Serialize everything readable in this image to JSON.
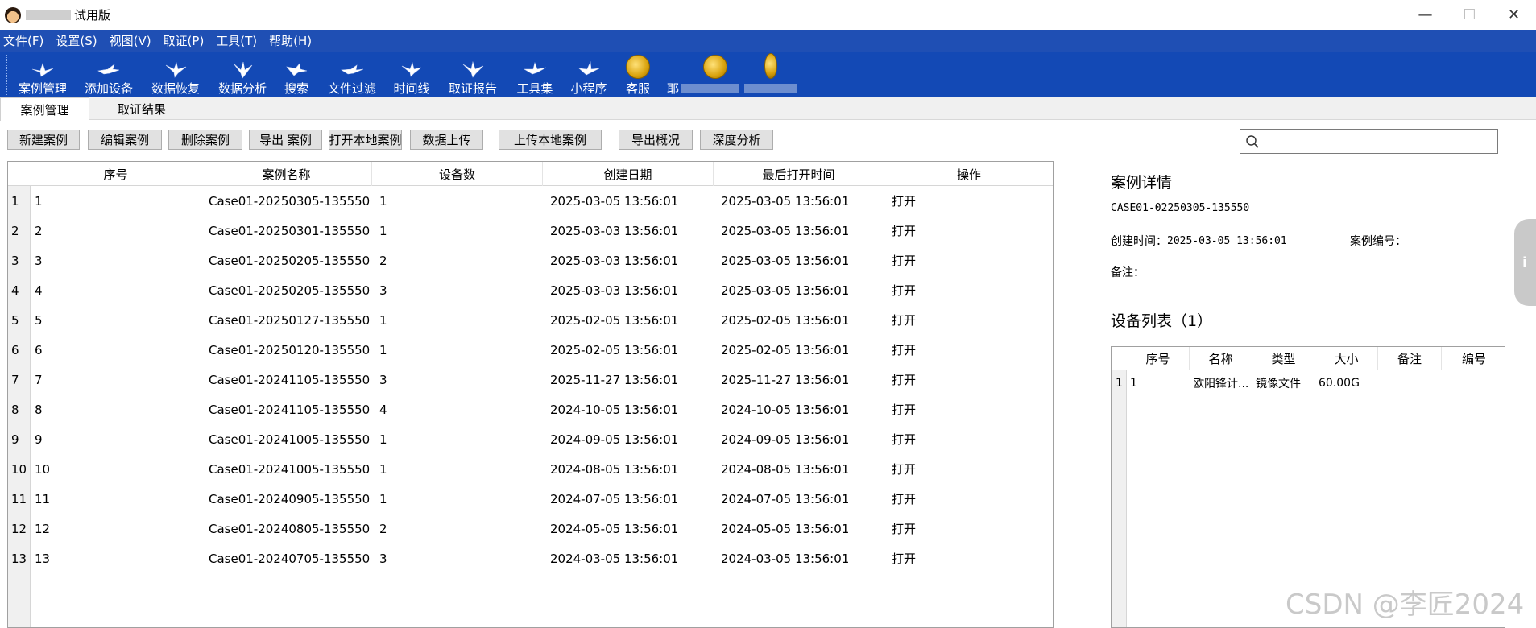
{
  "window": {
    "title": "试用版",
    "minimize_glyph": "—",
    "maximize_glyph": "☐",
    "close_glyph": "✕"
  },
  "menu": [
    "文件(F)",
    "设置(S)",
    "视图(V)",
    "取证(P)",
    "工具(T)",
    "帮助(H)"
  ],
  "toolbar": [
    {
      "label": "案例管理",
      "icon": "bird-icon"
    },
    {
      "label": "添加设备",
      "icon": "bird-icon"
    },
    {
      "label": "数据恢复",
      "icon": "bird-icon"
    },
    {
      "label": "数据分析",
      "icon": "bird-icon"
    },
    {
      "label": "搜索",
      "icon": "bird-icon"
    },
    {
      "label": "文件过滤",
      "icon": "bird-icon"
    },
    {
      "label": "时间线",
      "icon": "bird-icon"
    },
    {
      "label": "取证报告",
      "icon": "bird-icon"
    },
    {
      "label": "工具集",
      "icon": "bird-icon"
    },
    {
      "label": "小程序",
      "icon": "bird-icon"
    },
    {
      "label": "客服",
      "icon": "coin-icon"
    },
    {
      "label": "耶",
      "icon": "coin-icon"
    }
  ],
  "tabs": [
    {
      "label": "案例管理",
      "active": true
    },
    {
      "label": "取证结果",
      "active": false
    }
  ],
  "actions": [
    "新建案例",
    "编辑案例",
    "删除案例",
    "导出 案例",
    "打开本地案例",
    "数据上传",
    "上传本地案例",
    "导出概况",
    "深度分析"
  ],
  "search": {
    "placeholder": ""
  },
  "case_table": {
    "columns": [
      "序号",
      "案例名称",
      "设备数",
      "创建日期",
      "最后打开时间",
      "操作"
    ],
    "rows": [
      {
        "n": "1",
        "id": "1",
        "name": "Case01-20250305-135550",
        "devices": "1",
        "created": "2025-03-05 13:56:01",
        "opened": "2025-03-05 13:56:01",
        "op": "打开"
      },
      {
        "n": "2",
        "id": "2",
        "name": "Case01-20250301-135550",
        "devices": "1",
        "created": "2025-03-03 13:56:01",
        "opened": "2025-03-05 13:56:01",
        "op": "打开"
      },
      {
        "n": "3",
        "id": "3",
        "name": "Case01-20250205-135550",
        "devices": "2",
        "created": "2025-03-03 13:56:01",
        "opened": "2025-03-05 13:56:01",
        "op": "打开"
      },
      {
        "n": "4",
        "id": "4",
        "name": "Case01-20250205-135550",
        "devices": "3",
        "created": "2025-03-03 13:56:01",
        "opened": "2025-03-05 13:56:01",
        "op": "打开"
      },
      {
        "n": "5",
        "id": "5",
        "name": "Case01-20250127-135550",
        "devices": "1",
        "created": "2025-02-05 13:56:01",
        "opened": "2025-02-05 13:56:01",
        "op": "打开"
      },
      {
        "n": "6",
        "id": "6",
        "name": "Case01-20250120-135550",
        "devices": "1",
        "created": "2025-02-05 13:56:01",
        "opened": "2025-02-05 13:56:01",
        "op": "打开"
      },
      {
        "n": "7",
        "id": "7",
        "name": "Case01-20241105-135550",
        "devices": "3",
        "created": "2025-11-27 13:56:01",
        "opened": "2025-11-27 13:56:01",
        "op": "打开"
      },
      {
        "n": "8",
        "id": "8",
        "name": "Case01-20241105-135550",
        "devices": "4",
        "created": "2024-10-05 13:56:01",
        "opened": "2024-10-05 13:56:01",
        "op": "打开"
      },
      {
        "n": "9",
        "id": "9",
        "name": "Case01-20241005-135550",
        "devices": "1",
        "created": "2024-09-05 13:56:01",
        "opened": "2024-09-05 13:56:01",
        "op": "打开"
      },
      {
        "n": "10",
        "id": "10",
        "name": "Case01-20241005-135550",
        "devices": "1",
        "created": "2024-08-05 13:56:01",
        "opened": "2024-08-05 13:56:01",
        "op": "打开"
      },
      {
        "n": "11",
        "id": "11",
        "name": "Case01-20240905-135550",
        "devices": "1",
        "created": "2024-07-05 13:56:01",
        "opened": "2024-07-05 13:56:01",
        "op": "打开"
      },
      {
        "n": "12",
        "id": "12",
        "name": "Case01-20240805-135550",
        "devices": "2",
        "created": "2024-05-05 13:56:01",
        "opened": "2024-05-05 13:56:01",
        "op": "打开"
      },
      {
        "n": "13",
        "id": "13",
        "name": "Case01-20240705-135550",
        "devices": "3",
        "created": "2024-03-05 13:56:01",
        "opened": "2024-03-05 13:56:01",
        "op": "打开"
      }
    ]
  },
  "detail": {
    "title": "案例详情",
    "case_code": "CASE01-02250305-135550",
    "created_label": "创建时间：",
    "created_value": "2025-03-05 13:56:01",
    "number_label": "案例编号：",
    "remark_label": "备注：",
    "device_list_title": "设备列表（1）",
    "device_columns": [
      "序号",
      "名称",
      "类型",
      "大小",
      "备注",
      "编号"
    ],
    "devices": [
      {
        "n": "1",
        "id": "1",
        "name": "欧阳锋计...",
        "type": "镜像文件",
        "size": "60.00G",
        "remark": "",
        "code": ""
      }
    ]
  },
  "watermark": "CSDN @李匠2024"
}
